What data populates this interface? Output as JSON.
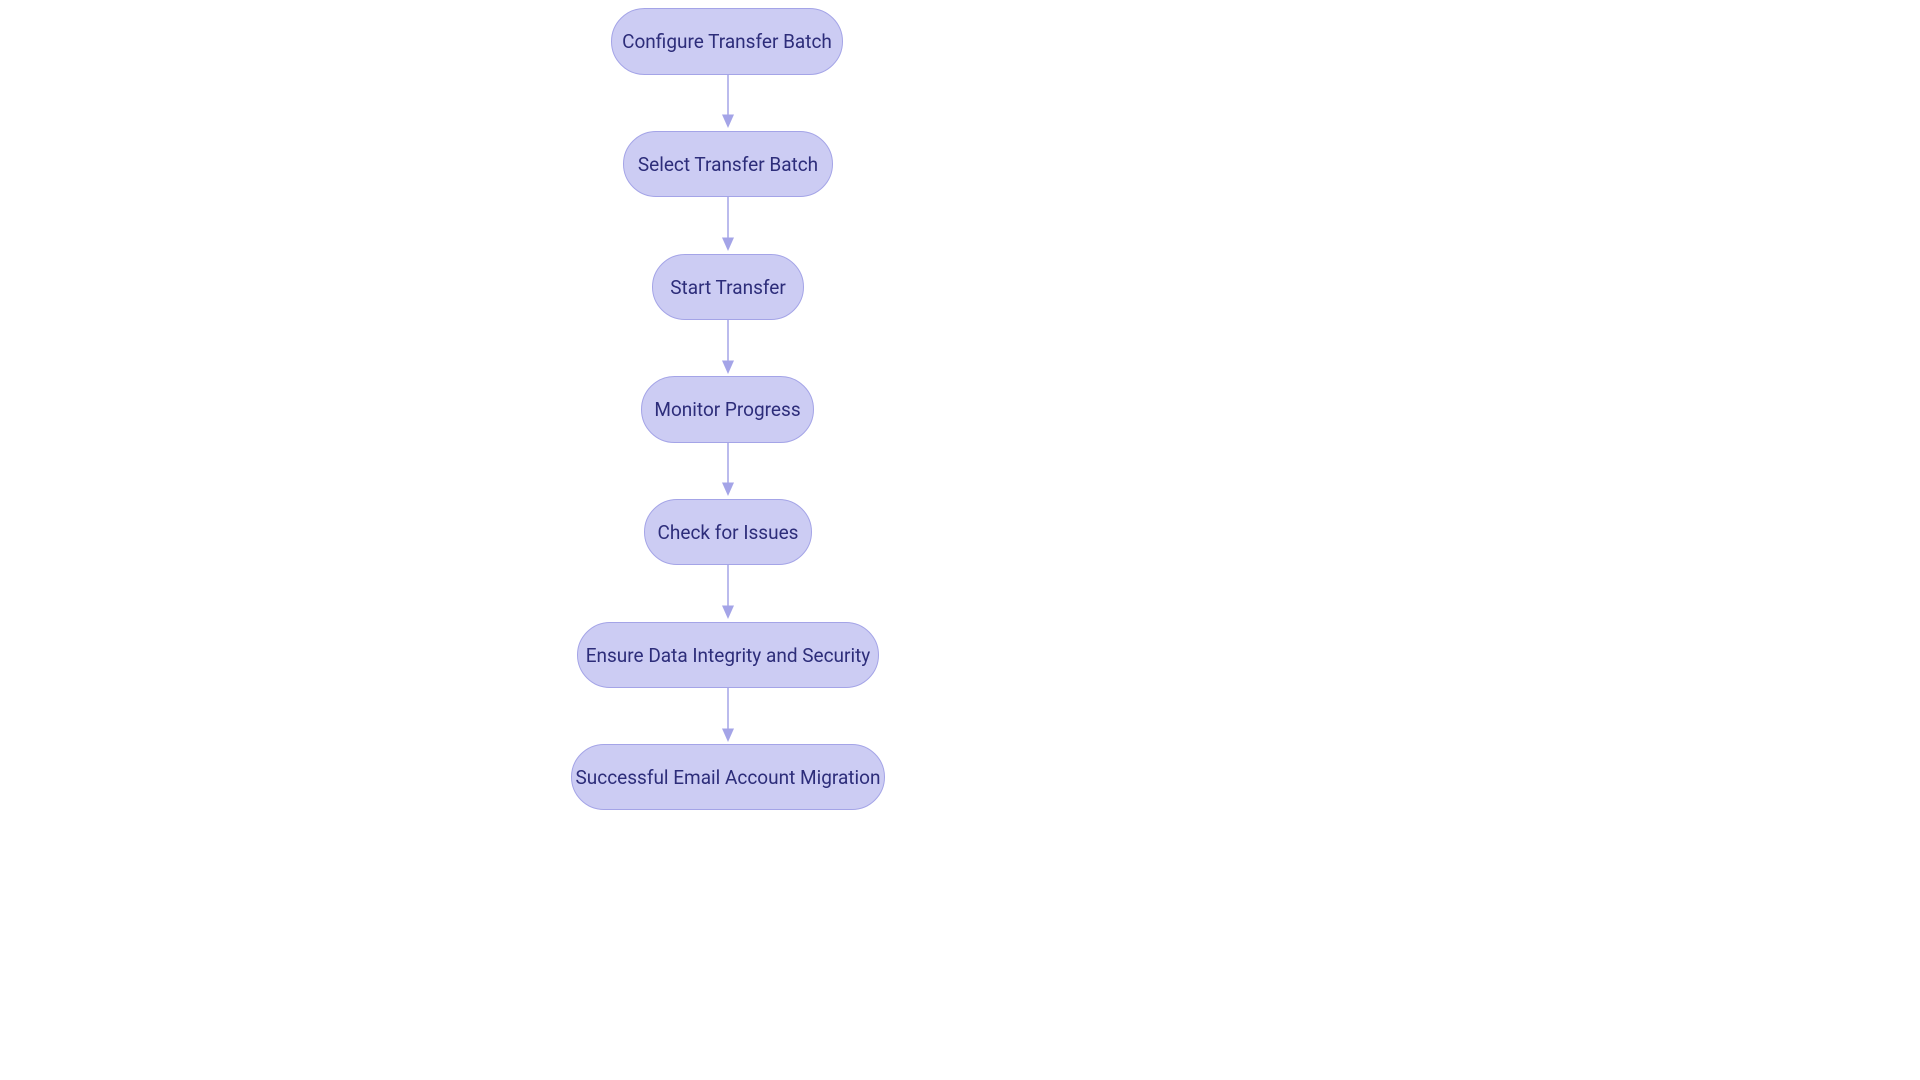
{
  "diagram": {
    "nodes": [
      {
        "id": "configure",
        "label": "Configure Transfer Batch"
      },
      {
        "id": "select",
        "label": "Select Transfer Batch"
      },
      {
        "id": "start",
        "label": "Start Transfer"
      },
      {
        "id": "monitor",
        "label": "Monitor Progress"
      },
      {
        "id": "check",
        "label": "Check for Issues"
      },
      {
        "id": "ensure",
        "label": "Ensure Data Integrity and Security"
      },
      {
        "id": "success",
        "label": "Successful Email Account Migration"
      }
    ],
    "edges": [
      {
        "from": "configure",
        "to": "select"
      },
      {
        "from": "select",
        "to": "start"
      },
      {
        "from": "start",
        "to": "monitor"
      },
      {
        "from": "monitor",
        "to": "check"
      },
      {
        "from": "check",
        "to": "ensure"
      },
      {
        "from": "ensure",
        "to": "success"
      }
    ],
    "colors": {
      "node_fill": "#ccccf3",
      "node_stroke": "#a4a4e7",
      "node_text": "#2d2d7a",
      "arrow": "#a4a4e7"
    }
  }
}
